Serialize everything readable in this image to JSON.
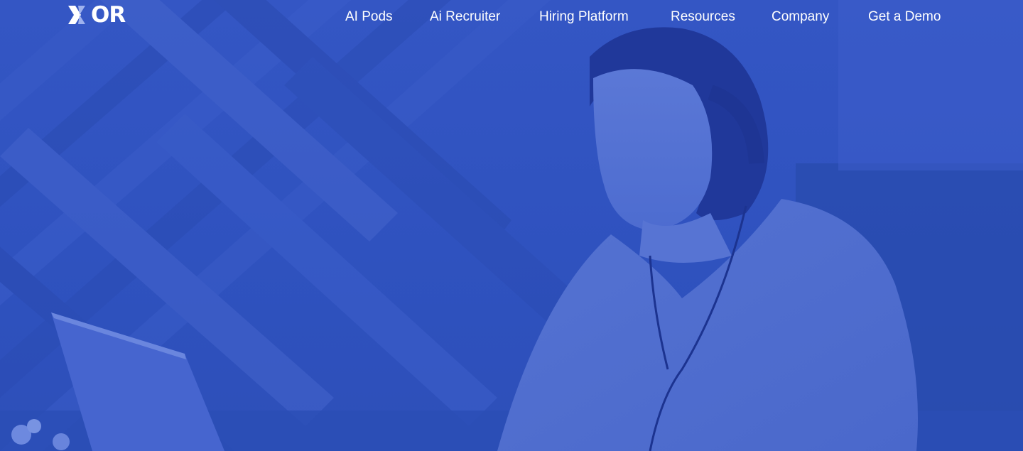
{
  "header": {
    "logo_text": "OR",
    "nav_items": [
      {
        "label": "AI Pods"
      },
      {
        "label": "Ai Recruiter"
      },
      {
        "label": "Hiring Platform"
      },
      {
        "label": "Resources"
      },
      {
        "label": "Company"
      },
      {
        "label": "Get a Demo"
      }
    ]
  },
  "hero": {
    "overlay_color": "#2f52bf",
    "text_color": "#ffffff"
  }
}
